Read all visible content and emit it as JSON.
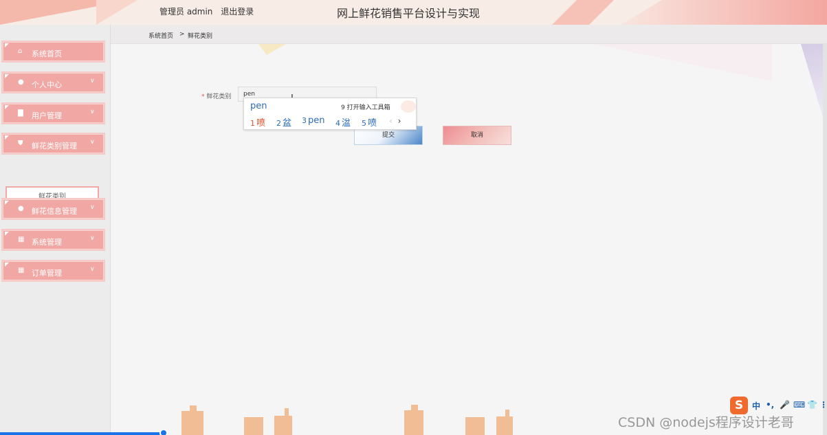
{
  "header": {
    "user_role": "管理员 admin",
    "logout": "退出登录",
    "title": "网上鲜花销售平台设计与实现"
  },
  "breadcrumb": {
    "home": "系统首页",
    "separator": ">",
    "current": "鲜花类别"
  },
  "sidebar": {
    "items": [
      {
        "label": "系统首页",
        "icon": "home-icon",
        "has_chevron": false
      },
      {
        "label": "个人中心",
        "icon": "user-icon",
        "has_chevron": true
      },
      {
        "label": "用户管理",
        "icon": "chart-icon",
        "has_chevron": true
      },
      {
        "label": "鲜花类别管理",
        "icon": "shield-icon",
        "has_chevron": true
      },
      {
        "label": "鲜花信息管理",
        "icon": "user-icon",
        "has_chevron": true
      },
      {
        "label": "系统管理",
        "icon": "grid-icon",
        "has_chevron": true
      },
      {
        "label": "订单管理",
        "icon": "grid-icon",
        "has_chevron": true
      }
    ],
    "submenu_item": "鲜花类别"
  },
  "form": {
    "field_required_mark": "*",
    "field_label": "鲜花类别",
    "field_value": "pen",
    "submit_label": "提交",
    "cancel_label": "取消"
  },
  "ime": {
    "composition": "pen",
    "toolbox": "9 打开输入工具箱",
    "candidates": [
      {
        "num": "1",
        "text": "喷"
      },
      {
        "num": "2",
        "text": "盆"
      },
      {
        "num": "3",
        "text": "pen"
      },
      {
        "num": "4",
        "text": "湓"
      },
      {
        "num": "5",
        "text": "喷"
      }
    ],
    "prev": "‹",
    "next": "›"
  },
  "ime_status_bar": {
    "logo": "S",
    "items": [
      "中",
      "•,",
      "🎤",
      "⌨",
      "👕",
      "⋮"
    ]
  },
  "watermark": "CSDN @nodejs程序设计老哥",
  "colors": {
    "accent_pink": "#f1a8a4",
    "submit_blue": "#4b86c9",
    "cancel_pink": "#ee8c92",
    "ime_blue": "#2b6cb8",
    "ime_first": "#e0522b"
  }
}
